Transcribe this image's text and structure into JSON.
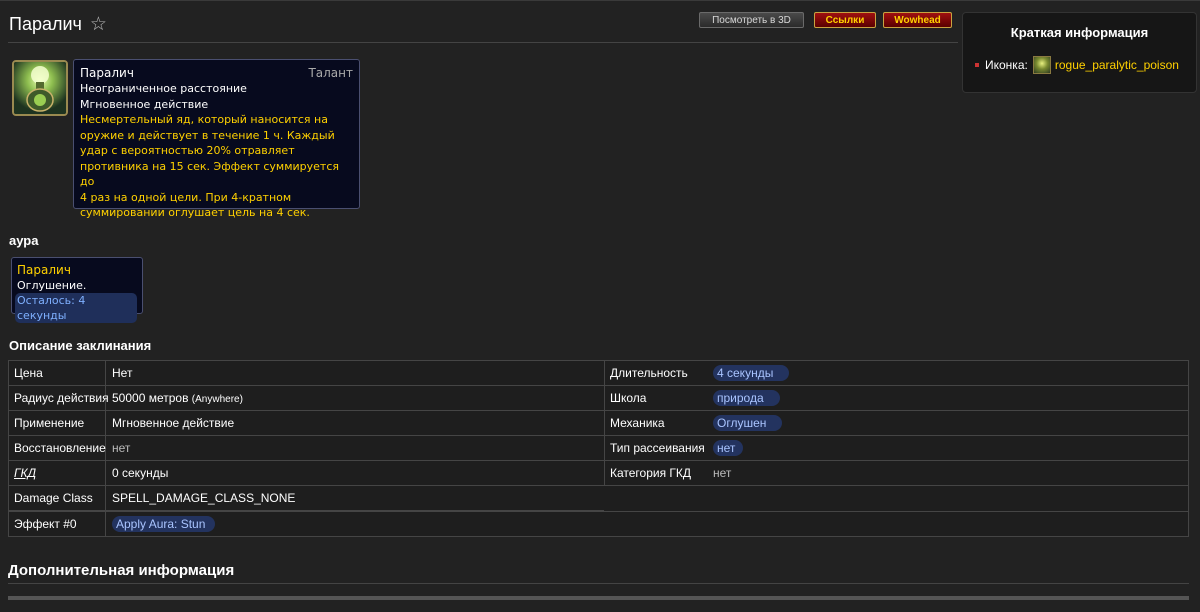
{
  "page": {
    "title": "Паралич",
    "buttons": {
      "view3d": "Посмотреть в 3D",
      "links": "Ссылки",
      "wowhead": "Wowhead"
    }
  },
  "infobox": {
    "title": "Краткая информация",
    "icon_label": "Иконка:",
    "icon_name": "rogue_paralytic_poison"
  },
  "tooltip": {
    "name": "Паралич",
    "type": "Талант",
    "range": "Неограниченное расстояние",
    "cast": "Мгновенное действие",
    "description_lines": [
      "Несмертельный яд, который наносится на",
      "оружие и действует в течение 1 ч. Каждый",
      "удар с вероятностью 20% отравляет",
      "противника на 15 сек. Эффект суммируется до",
      "4 раз на одной цели. При 4-кратном",
      "суммировании оглушает цель на 4 сек."
    ]
  },
  "aura": {
    "section_title": "аура",
    "name": "Паралич",
    "description": "Оглушение.",
    "remaining": "Осталось: 4 секунды"
  },
  "spell_info": {
    "section_title": "Описание заклинания",
    "left_rows": [
      {
        "label": "Цена",
        "value": "Нет"
      },
      {
        "label": "Радиус действия",
        "value": "50000 метров",
        "extra": "(Anywhere)"
      },
      {
        "label": "Применение",
        "value": "Мгновенное действие"
      },
      {
        "label": "Восстановление",
        "value": "нет"
      },
      {
        "label": "ГКД",
        "value": "0 секунды"
      },
      {
        "label": "Damage Class",
        "value": "SPELL_DAMAGE_CLASS_NONE"
      }
    ],
    "right_rows": [
      {
        "label": "Длительность",
        "value": "4 секунды"
      },
      {
        "label": "Школа",
        "value": "природа"
      },
      {
        "label": "Механика",
        "value": "Оглушен"
      },
      {
        "label": "Тип рассеивания",
        "value": "нет"
      },
      {
        "label": "Категория ГКД",
        "value": "нет"
      }
    ],
    "effect_row": {
      "label": "Эффект #0",
      "value": "Apply Aura: Stun"
    }
  },
  "extra": {
    "section_title": "Дополнительная информация"
  },
  "colors": {
    "background": "#222222",
    "gold": "#ffd100",
    "tooltip_bg": "#070a1e",
    "highlight": "#23335f"
  }
}
